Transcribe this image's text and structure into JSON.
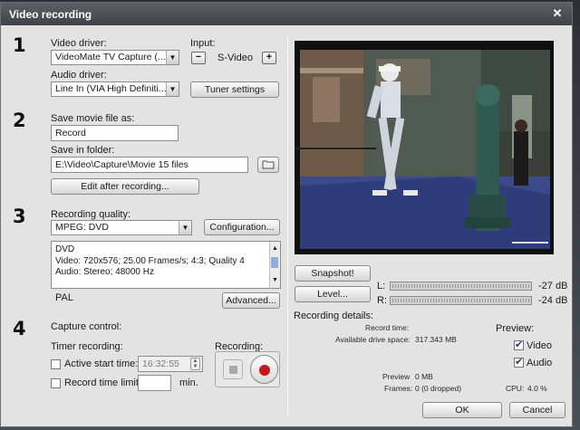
{
  "window": {
    "title": "Video recording"
  },
  "sections": {
    "one": "1",
    "two": "2",
    "three": "3",
    "four": "4"
  },
  "video_driver": {
    "label": "Video driver:",
    "value": "VideoMate TV Capture (..."
  },
  "input": {
    "label": "Input:",
    "minus": "−",
    "value": "S-Video",
    "plus": "+"
  },
  "audio_driver": {
    "label": "Audio driver:",
    "value": "Line In (VIA High Definiti..."
  },
  "tuner_settings_label": "Tuner settings",
  "save": {
    "file_label": "Save movie file as:",
    "file_value": "Record",
    "folder_label": "Save in folder:",
    "folder_value": "E:\\Video\\Capture\\Movie 15 files",
    "edit_after_label": "Edit after recording..."
  },
  "quality": {
    "label": "Recording quality:",
    "value": "MPEG: DVD",
    "configuration_label": "Configuration...",
    "details": [
      "DVD",
      "Video: 720x576; 25.00 Frames/s; 4:3; Quality 4",
      "Audio: Stereo; 48000 Hz"
    ],
    "standard": "PAL",
    "advanced_label": "Advanced..."
  },
  "capture": {
    "label": "Capture control:",
    "timer_label": "Timer recording:",
    "recording_label": "Recording:",
    "active_start_label": "Active start time:",
    "active_start_checked": false,
    "start_time": "16:32:55",
    "record_limit_label": "Record time limit:",
    "record_limit_checked": false,
    "limit_value": "",
    "limit_unit": "min."
  },
  "preview_controls": {
    "snapshot_label": "Snapshot!",
    "level_label": "Level...",
    "left_channel": "L:",
    "right_channel": "R:",
    "left_db": "-27 dB",
    "right_db": "-24 dB"
  },
  "details": {
    "title": "Recording details:",
    "record_time_label": "Record time:",
    "drive_space_label": "Available drive space:",
    "drive_space_value": "317.343 MB",
    "preview_size_label": "Preview",
    "preview_size_value": "0 MB",
    "frames_label": "Frames:",
    "frames_value": "0 (0 dropped)",
    "cpu_label": "CPU:",
    "cpu_value": "4.0 %"
  },
  "preview": {
    "label": "Preview:",
    "video_label": "Video",
    "video_checked": true,
    "audio_label": "Audio",
    "audio_checked": true
  },
  "footer": {
    "ok_label": "OK",
    "cancel_label": "Cancel"
  },
  "colors": {
    "title_bar": "#4a4e53",
    "dialog": "#e3e3e3",
    "record_red": "#c8141c"
  }
}
